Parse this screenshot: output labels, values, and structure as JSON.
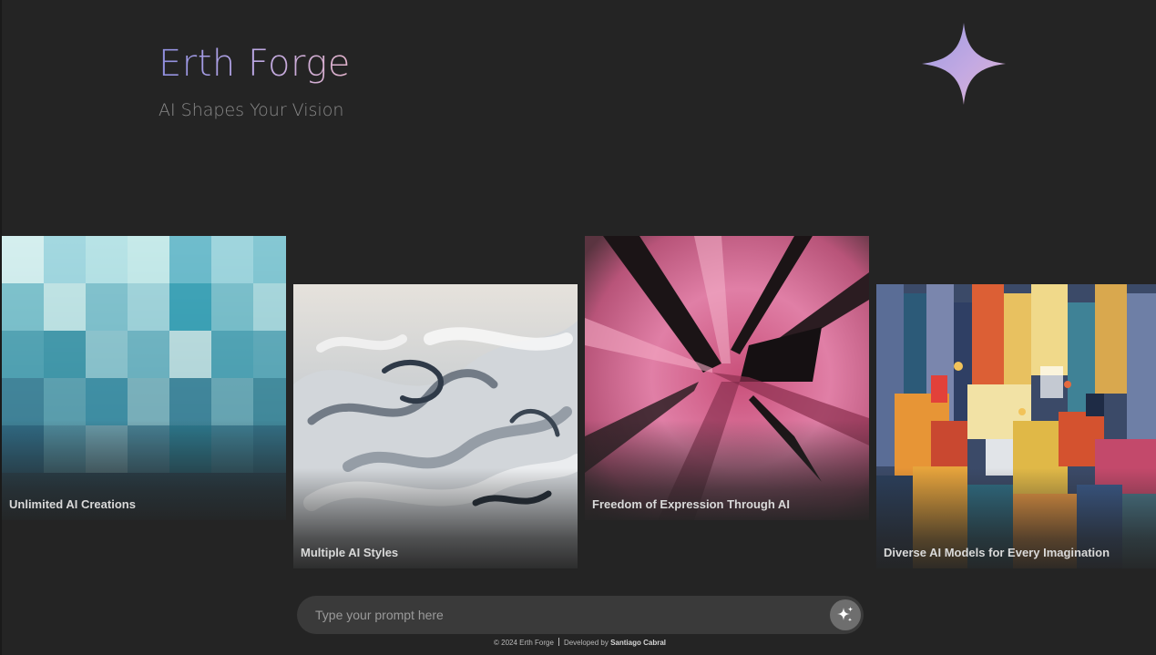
{
  "brand": {
    "title": "Erth Forge",
    "subtitle": "AI Shapes Your Vision",
    "logo_icon": "sparkle-icon",
    "gradient_colors": [
      "#8f8fe0",
      "#b7a6e6",
      "#e0b1c9"
    ]
  },
  "cards": [
    {
      "caption": "Unlimited AI Creations",
      "image": "teal-blue-checker-painting",
      "colors": [
        "#a9dfe6",
        "#3aa1b5",
        "#2a5a72"
      ]
    },
    {
      "caption": "Multiple AI Styles",
      "image": "grey-white-swirl-painting",
      "colors": [
        "#e4e0da",
        "#a7b0b8",
        "#3d4753"
      ]
    },
    {
      "caption": "Freedom of Expression Through AI",
      "image": "pink-black-burst-painting",
      "colors": [
        "#e27aa3",
        "#b93a67",
        "#1c1416"
      ]
    },
    {
      "caption": "Diverse AI Models for Every Imagination",
      "image": "colorful-abstract-city-painting",
      "colors": [
        "#e0a23a",
        "#d8542f",
        "#2c5d7a"
      ]
    }
  ],
  "prompt": {
    "placeholder": "Type your prompt here",
    "value": "",
    "submit_icon": "sparkles-icon"
  },
  "footer": {
    "copyright": "© 2024 Erth Forge",
    "developed_by_label": "Developed by",
    "developer_name": "Santiago Cabral"
  },
  "colors": {
    "background": "#242424",
    "prompt_bar": "#3a3a3a",
    "submit_button": "#6e6e6e"
  }
}
